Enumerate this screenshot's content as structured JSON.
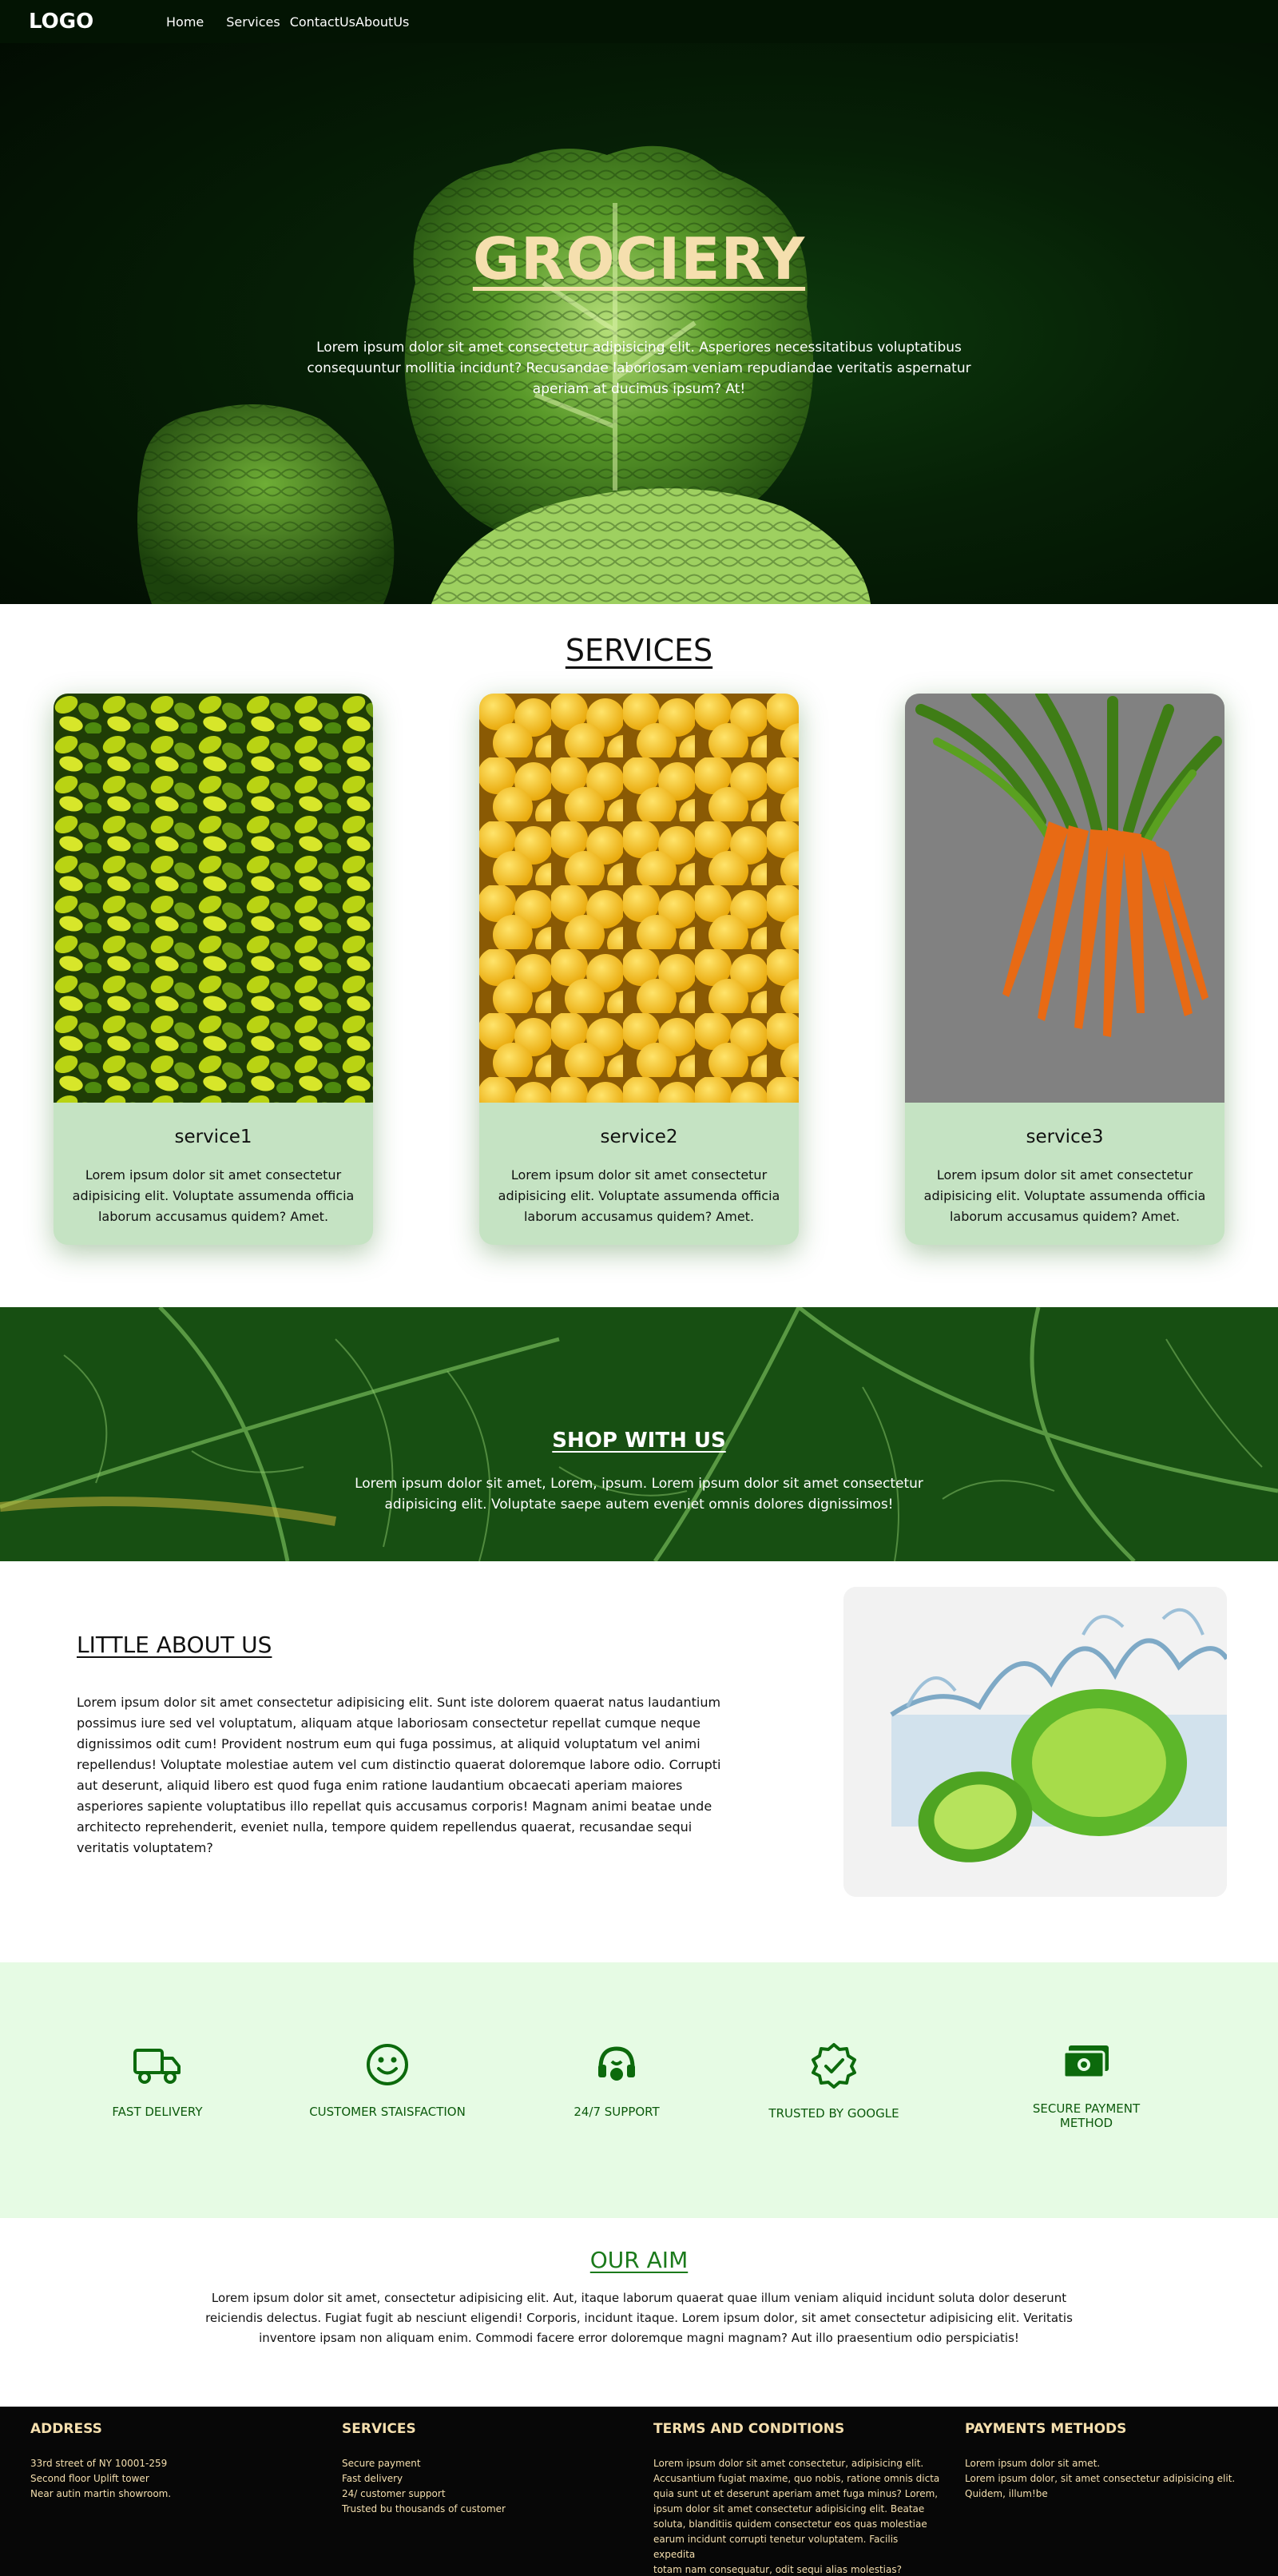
{
  "nav": {
    "logo": "LOGO",
    "links": [
      "Home",
      "Services",
      "Contact",
      "Us",
      "About",
      "Us"
    ]
  },
  "hero": {
    "title": "GROCIERY",
    "text": "Lorem ipsum dolor sit amet consectetur adipisicing elit. Asperiores necessitatibus voluptatibus consequuntur mollitia incidunt? Recusandae laboriosam veniam repudiandae veritatis aspernatur aperiam at ducimus ipsum? At!"
  },
  "services": {
    "title": "SERVICES",
    "cards": [
      {
        "title": "service1",
        "text": "Lorem ipsum dolor sit amet consectetur adipisicing elit. Voluptate assumenda officia laborum accusamus quidem? Amet."
      },
      {
        "title": "service2",
        "text": "Lorem ipsum dolor sit amet consectetur adipisicing elit. Voluptate assumenda officia laborum accusamus quidem? Amet."
      },
      {
        "title": "service3",
        "text": "Lorem ipsum dolor sit amet consectetur adipisicing elit. Voluptate assumenda officia laborum accusamus quidem? Amet."
      }
    ]
  },
  "shop": {
    "title": "SHOP WITH US",
    "text": "Lorem ipsum dolor sit amet, Lorem, ipsum. Lorem ipsum dolor sit amet consectetur adipisicing elit. Voluptate saepe autem eveniet omnis dolores dignissimos!"
  },
  "about": {
    "title": "LITTLE ABOUT US",
    "text": "Lorem ipsum dolor sit amet consectetur adipisicing elit. Sunt iste dolorem quaerat natus laudantium possimus iure sed vel voluptatum, aliquam atque laboriosam consectetur repellat cumque neque dignissimos odit cum! Provident nostrum eum qui fuga possimus, at aliquid voluptatum vel animi repellendus! Voluptate molestiae autem vel cum distinctio quaerat doloremque labore odio. Corrupti aut deserunt, aliquid libero est quod fuga enim ratione laudantium obcaecati aperiam maiores asperiores sapiente voluptatibus illo repellat quis accusamus corporis! Magnam animi beatae unde architecto reprehenderit, eveniet nulla, tempore quidem repellendus quaerat, recusandae sequi veritatis voluptatem?"
  },
  "features": [
    {
      "label": "FAST DELIVERY",
      "icon": "truck-icon"
    },
    {
      "label": "CUSTOMER STAISFACTION",
      "icon": "smiley-icon"
    },
    {
      "label": "24/7 SUPPORT",
      "icon": "headset-icon"
    },
    {
      "label": "TRUSTED BY GOOGLE",
      "icon": "verified-badge-icon"
    },
    {
      "label": "SECURE PAYMENT METHOD",
      "icon": "cash-icon"
    }
  ],
  "aim": {
    "title": "OUR AIM",
    "text": "Lorem ipsum dolor sit amet, consectetur adipisicing elit. Aut, itaque laborum quaerat quae illum veniam aliquid incidunt soluta dolor deserunt reiciendis delectus. Fugiat fugit ab nesciunt eligendi! Corporis, incidunt itaque. Lorem ipsum dolor, sit amet consectetur adipisicing elit. Veritatis inventore ipsam non aliquam enim. Commodi facere error doloremque magni magnam? Aut illo praesentium odio perspiciatis!"
  },
  "footer": {
    "address": {
      "title": "ADDRESS",
      "lines": [
        "33rd street of NY 10001-259",
        "Second floor Uplift tower",
        "Near autin martin showroom."
      ]
    },
    "services": {
      "title": "SERVICES",
      "lines": [
        "Secure payment",
        "Fast delivery",
        "24/ customer support",
        "Trusted bu thousands of customer"
      ]
    },
    "terms": {
      "title": "TERMS AND CONDITIONS",
      "lines": [
        "Lorem ipsum dolor sit amet consectetur, adipisicing elit.",
        "Accusantium fugiat maxime, quo nobis, ratione omnis dicta",
        "quia sunt ut et deserunt aperiam amet fuga minus? Lorem,",
        "ipsum dolor sit amet consectetur adipisicing elit. Beatae",
        "soluta, blanditiis quidem consectetur eos quas molestiae",
        "earum incidunt corrupti tenetur voluptatem. Facilis expedita",
        "totam nam consequatur, odit sequi alias molestias?"
      ]
    },
    "payments": {
      "title": "PAYMENTS METHODS",
      "lines": [
        "Lorem ipsum dolor sit amet.",
        "Lorem ipsum dolor, sit amet consectetur adipisicing elit.",
        "Quidem, illum!be"
      ]
    }
  },
  "colors": {
    "hero_title": "#f5dfae",
    "nav_bg": "#031403",
    "card_bg": "#c5e3c3",
    "feature_bg": "#e6fbe4",
    "feature_icon": "#0c6a0c",
    "aim_title": "#1b7a1b",
    "footer_bg": "#070707",
    "footer_text": "#f5dfae"
  }
}
